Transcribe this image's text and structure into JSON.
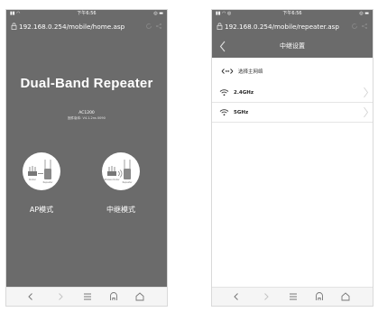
{
  "status_bar": {
    "time": "下午6:56"
  },
  "left": {
    "url": "192.168.0.254/mobile/home.asp",
    "brand_title": "Dual-Band Repeater",
    "model": "AC1200",
    "firmware": "固件版本: V4.1.2ns 0090",
    "ap_device_label": "Router",
    "ap_repeater_label": "Repeater",
    "rep_device_label": "Wireless Router",
    "rep_repeater_label": "Repeater",
    "ap_mode_label": "AP模式",
    "repeater_mode_label": "中继模式"
  },
  "right": {
    "url": "192.168.0.254/mobile/repeater.asp",
    "page_title": "中继设置",
    "section_label": "选择主网络",
    "bands": [
      "2.4GHz",
      "5GHz"
    ]
  },
  "toolbar": {
    "icons": [
      "back-icon",
      "forward-icon",
      "menu-icon",
      "home-icon",
      "tabs-icon"
    ]
  },
  "colors": {
    "header_bg": "#6b6b6b",
    "content_bg": "#ffffff",
    "toolbar_bg": "#f5f5f5"
  }
}
